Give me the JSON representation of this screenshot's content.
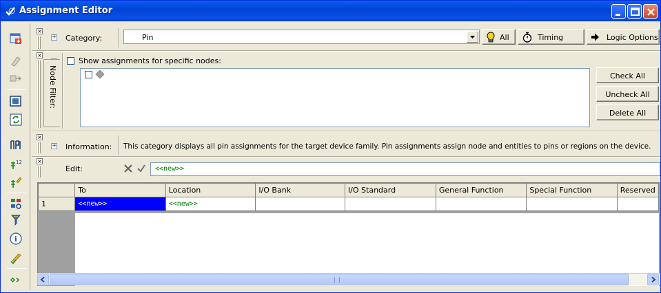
{
  "window": {
    "title": "Assignment Editor"
  },
  "category": {
    "label": "Category:",
    "value": "Pin",
    "expander": "+"
  },
  "buttons": {
    "all": "All",
    "timing": "Timing",
    "logic_options": "Logic Options"
  },
  "node_filter": {
    "tab_label": "Node Filter:",
    "show_label": "Show assignments for specific nodes:",
    "check_all": "Check All",
    "uncheck_all": "Uncheck All",
    "delete_all": "Delete All",
    "expander": "−"
  },
  "information": {
    "label": "Information:",
    "expander": "+",
    "text": "This category displays all pin assignments for the target device family. Pin assignments assign node and entities to pins or regions on the device."
  },
  "edit": {
    "label": "Edit:",
    "value": "<<new>>"
  },
  "table": {
    "columns": [
      "To",
      "Location",
      "I/O Bank",
      "I/O Standard",
      "General Function",
      "Special Function",
      "Reserved"
    ],
    "rows": [
      {
        "num": "1",
        "to": "<<new>>",
        "location": "<<new>>",
        "io_bank": "",
        "io_standard": "",
        "general": "",
        "special": "",
        "reserved": ""
      }
    ]
  },
  "colors": {
    "title_bar": "#0054e3",
    "selection": "#0000ff",
    "new_text": "#008000"
  },
  "toolbar_icons": [
    "new-assignment-icon",
    "eraser-icon",
    "export-icon",
    "window-icon",
    "refresh-icon",
    "pin-planner-icon",
    "pin-numbers-icon",
    "pin-edit-icon",
    "node-finder-icon",
    "filter-icon",
    "info-icon",
    "check-icon",
    "expand-icon"
  ]
}
